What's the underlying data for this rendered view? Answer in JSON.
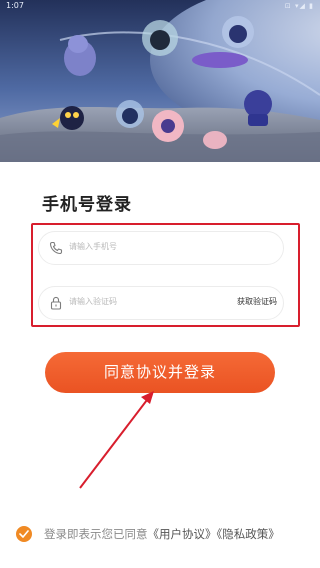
{
  "status_bar": {
    "time": "1:07",
    "icons": "⊡ ▾◢ ▮"
  },
  "page_title": "手机号登录",
  "phone_field": {
    "placeholder": "请输入手机号",
    "icon": "phone-icon"
  },
  "code_field": {
    "placeholder": "请输入验证码",
    "icon": "lock-icon",
    "get_code_label": "获取验证码"
  },
  "login_button": {
    "label": "同意协议并登录"
  },
  "agreement": {
    "checked": true,
    "prefix": "登录即表示您已同意",
    "user_agreement": "《用户协议》",
    "privacy_policy": "《隐私政策》"
  },
  "colors": {
    "accent": "#ee5a28",
    "annotation_red": "#d81e2d",
    "checkbox": "#f08a24",
    "title": "#222222"
  }
}
